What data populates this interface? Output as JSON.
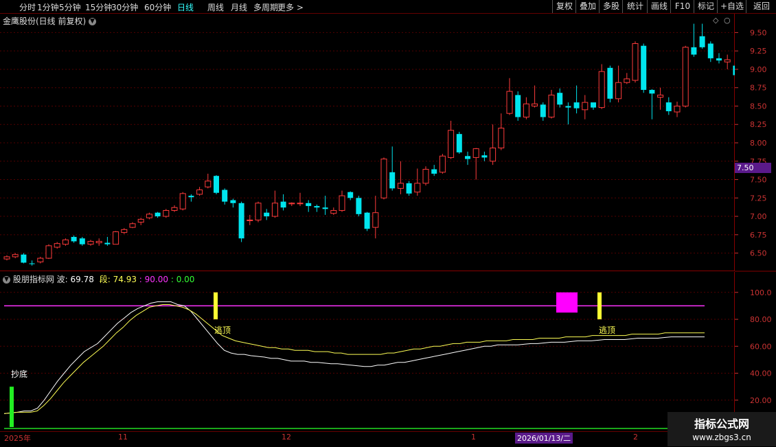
{
  "toolbar": {
    "left_items": [
      "分时",
      "1分钟",
      "5分钟",
      "15分钟",
      "30分钟",
      "60分钟",
      "日线",
      "周线",
      "月线",
      "多周期",
      "更多 >"
    ],
    "active": "日线",
    "right_items": [
      "复权",
      "叠加",
      "多股",
      "统计",
      "画线",
      "F10",
      "标记",
      "+自选",
      "返回"
    ]
  },
  "price_panel": {
    "title": "金鹰股份(日线 前复权)",
    "y_ticks": [
      "9.50",
      "9.25",
      "9.00",
      "8.75",
      "8.50",
      "8.25",
      "8.00",
      "7.75",
      "7.50",
      "7.25",
      "7.00",
      "6.75",
      "6.50"
    ],
    "cursor_price": "7.50"
  },
  "indicator_panel": {
    "name": "股朋指标网",
    "bo_label": "波:",
    "bo_value": "69.78",
    "duan_label": "段:",
    "duan_value": "74.93",
    "level_value": ": 90.00",
    "zero_value": ": 0.00",
    "y_ticks": [
      "100.0",
      "80.00",
      "60.00",
      "40.00",
      "20.00"
    ],
    "signal_buy": "抄底",
    "signal_sell_1": "逃顶",
    "signal_sell_2": "逃顶"
  },
  "date_axis": {
    "start": "2025年",
    "m11": "11",
    "m12": "12",
    "m1": "1",
    "cursor_date": "2026/01/13/二",
    "m2": "2"
  },
  "watermark": {
    "title": "指标公式网",
    "url": "www.zbgs3.cn"
  },
  "colors": {
    "up": "#ff3b3b",
    "down": "#00e5ee",
    "wave": "#ffffff",
    "segment": "#ffff55",
    "level": "#ff33ff",
    "grid": "#550000"
  },
  "chart_data": {
    "type": "candlestick",
    "price_ylim": [
      6.3,
      9.7
    ],
    "candles": [
      [
        6.42,
        6.45,
        6.4,
        6.47
      ],
      [
        6.45,
        6.48,
        6.43,
        6.5
      ],
      [
        6.48,
        6.37,
        6.36,
        6.5
      ],
      [
        6.36,
        6.35,
        6.33,
        6.4
      ],
      [
        6.38,
        6.43,
        6.36,
        6.45
      ],
      [
        6.43,
        6.6,
        6.42,
        6.62
      ],
      [
        6.58,
        6.63,
        6.56,
        6.65
      ],
      [
        6.62,
        6.68,
        6.6,
        6.7
      ],
      [
        6.72,
        6.66,
        6.64,
        6.74
      ],
      [
        6.7,
        6.62,
        6.6,
        6.72
      ],
      [
        6.62,
        6.66,
        6.6,
        6.68
      ],
      [
        6.64,
        6.66,
        6.6,
        6.7
      ],
      [
        6.64,
        6.62,
        6.6,
        6.72
      ],
      [
        6.62,
        6.79,
        6.62,
        6.8
      ],
      [
        6.78,
        6.82,
        6.76,
        6.84
      ],
      [
        6.85,
        6.9,
        6.84,
        6.92
      ],
      [
        6.92,
        6.96,
        6.88,
        6.98
      ],
      [
        6.98,
        7.03,
        6.96,
        7.05
      ],
      [
        7.05,
        7.0,
        6.98,
        7.06
      ],
      [
        7.0,
        7.08,
        6.98,
        7.1
      ],
      [
        7.08,
        7.12,
        7.06,
        7.15
      ],
      [
        7.1,
        7.31,
        7.08,
        7.33
      ],
      [
        7.28,
        7.26,
        7.2,
        7.3
      ],
      [
        7.3,
        7.36,
        7.28,
        7.4
      ],
      [
        7.4,
        7.48,
        7.38,
        7.58
      ],
      [
        7.55,
        7.32,
        7.3,
        7.56
      ],
      [
        7.36,
        7.2,
        7.16,
        7.38
      ],
      [
        7.22,
        7.18,
        7.12,
        7.24
      ],
      [
        7.18,
        6.7,
        6.65,
        7.2
      ],
      [
        6.95,
        6.95,
        6.88,
        7.02
      ],
      [
        6.95,
        7.18,
        6.92,
        7.2
      ],
      [
        7.05,
        7.0,
        6.95,
        7.1
      ],
      [
        7.0,
        7.18,
        6.98,
        7.35
      ],
      [
        7.2,
        7.12,
        7.08,
        7.3
      ],
      [
        7.17,
        7.18,
        7.14,
        7.19
      ],
      [
        7.18,
        7.18,
        7.14,
        7.32
      ],
      [
        7.18,
        7.14,
        7.06,
        7.22
      ],
      [
        7.14,
        7.12,
        7.06,
        7.16
      ],
      [
        7.12,
        7.1,
        7.02,
        7.28
      ],
      [
        7.04,
        7.08,
        7.02,
        7.12
      ],
      [
        7.08,
        7.28,
        7.06,
        7.35
      ],
      [
        7.33,
        7.25,
        7.22,
        7.34
      ],
      [
        7.25,
        7.03,
        7.0,
        7.28
      ],
      [
        7.05,
        6.83,
        6.8,
        7.06
      ],
      [
        6.85,
        7.05,
        6.7,
        7.28
      ],
      [
        7.25,
        7.78,
        7.23,
        7.8
      ],
      [
        7.6,
        7.38,
        7.35,
        7.95
      ],
      [
        7.38,
        7.45,
        7.3,
        7.75
      ],
      [
        7.45,
        7.31,
        7.28,
        7.48
      ],
      [
        7.33,
        7.45,
        7.28,
        7.65
      ],
      [
        7.45,
        7.64,
        7.42,
        7.68
      ],
      [
        7.64,
        7.58,
        7.55,
        7.7
      ],
      [
        7.6,
        7.82,
        7.58,
        7.85
      ],
      [
        7.8,
        8.17,
        7.78,
        8.3
      ],
      [
        8.12,
        7.87,
        7.85,
        8.15
      ],
      [
        7.82,
        7.78,
        7.7,
        7.88
      ],
      [
        7.8,
        7.92,
        7.5,
        7.93
      ],
      [
        7.83,
        7.8,
        7.75,
        7.88
      ],
      [
        7.75,
        7.93,
        7.7,
        8.25
      ],
      [
        7.93,
        8.2,
        7.9,
        8.4
      ],
      [
        8.4,
        8.7,
        8.38,
        8.88
      ],
      [
        8.65,
        8.35,
        8.3,
        8.7
      ],
      [
        8.35,
        8.53,
        8.32,
        8.62
      ],
      [
        8.5,
        8.53,
        8.48,
        8.78
      ],
      [
        8.52,
        8.35,
        8.3,
        8.55
      ],
      [
        8.35,
        8.65,
        8.33,
        8.72
      ],
      [
        8.68,
        8.52,
        8.48,
        8.74
      ],
      [
        8.5,
        8.48,
        8.25,
        8.55
      ],
      [
        8.55,
        8.47,
        8.4,
        8.78
      ],
      [
        8.45,
        8.55,
        8.32,
        8.65
      ],
      [
        8.55,
        8.48,
        8.45,
        8.52
      ],
      [
        8.48,
        8.97,
        8.46,
        9.07
      ],
      [
        9.02,
        8.6,
        8.55,
        9.05
      ],
      [
        8.6,
        8.82,
        8.55,
        9.05
      ],
      [
        8.82,
        8.87,
        8.8,
        8.95
      ],
      [
        8.85,
        9.35,
        8.82,
        9.38
      ],
      [
        9.32,
        8.72,
        8.68,
        9.35
      ],
      [
        8.72,
        8.67,
        8.32,
        8.73
      ],
      [
        8.62,
        8.65,
        8.45,
        8.75
      ],
      [
        8.55,
        8.43,
        8.38,
        8.62
      ],
      [
        8.42,
        8.5,
        8.35,
        8.56
      ],
      [
        8.5,
        9.3,
        8.48,
        9.32
      ],
      [
        9.3,
        9.2,
        9.17,
        9.62
      ],
      [
        9.45,
        9.3,
        9.28,
        9.62
      ],
      [
        9.35,
        9.15,
        9.1,
        9.38
      ],
      [
        9.15,
        9.12,
        9.08,
        9.22
      ],
      [
        9.1,
        9.13,
        9.0,
        9.2
      ],
      [
        9.05,
        8.92,
        8.9,
        9.1
      ],
      [
        8.95,
        8.78,
        8.75,
        8.98
      ],
      [
        8.78,
        8.72,
        8.7,
        8.97
      ],
      [
        8.7,
        8.72,
        8.7,
        8.9
      ]
    ],
    "indicator_ylim": [
      0,
      105
    ],
    "level": 90,
    "wave": [
      10,
      10.5,
      11,
      12,
      12,
      14,
      20,
      27,
      34,
      40,
      46,
      51,
      56,
      59,
      62,
      67,
      72,
      77,
      81,
      85,
      88,
      90,
      92,
      93,
      93,
      93,
      91,
      90,
      86,
      80,
      74,
      68,
      62,
      57,
      55,
      54,
      54,
      53,
      52.5,
      52,
      51,
      51,
      50,
      49,
      49,
      49,
      48,
      48,
      47.5,
      47,
      47,
      46.5,
      46,
      45.5,
      45,
      45,
      46,
      46,
      47,
      48,
      48,
      49,
      50,
      51,
      52,
      53,
      54,
      55,
      56,
      57,
      58,
      59,
      60,
      60,
      61,
      61,
      61,
      61,
      61.5,
      62,
      62,
      62.5,
      63,
      63,
      63,
      63.5,
      64,
      64,
      64,
      64.5,
      65,
      65,
      65,
      65,
      65.5,
      66,
      66,
      66,
      66,
      66.5,
      67,
      67,
      67,
      67,
      67,
      67
    ],
    "segment": [
      10,
      10.5,
      11,
      11,
      11,
      12,
      16,
      21,
      27,
      33,
      38,
      43,
      48,
      52,
      56,
      60,
      65,
      70,
      74,
      79,
      83,
      86,
      89,
      90,
      91,
      91,
      90,
      89,
      87,
      84,
      80,
      76,
      72,
      68,
      66,
      64,
      63,
      62,
      61,
      60,
      59,
      59,
      58,
      58,
      57,
      57,
      57,
      56,
      56,
      56,
      55,
      55,
      54,
      54,
      54,
      54,
      54,
      54,
      55,
      55,
      56,
      57,
      58,
      58,
      59,
      60,
      60,
      61,
      62,
      62,
      63,
      63,
      63,
      64,
      64,
      64,
      64,
      65,
      65,
      65,
      65,
      66,
      66,
      66,
      66,
      67,
      67,
      67,
      67,
      68,
      68,
      68,
      68,
      68,
      68,
      69,
      69,
      69,
      69,
      69,
      70,
      70,
      70,
      70,
      70,
      70,
      70
    ]
  }
}
